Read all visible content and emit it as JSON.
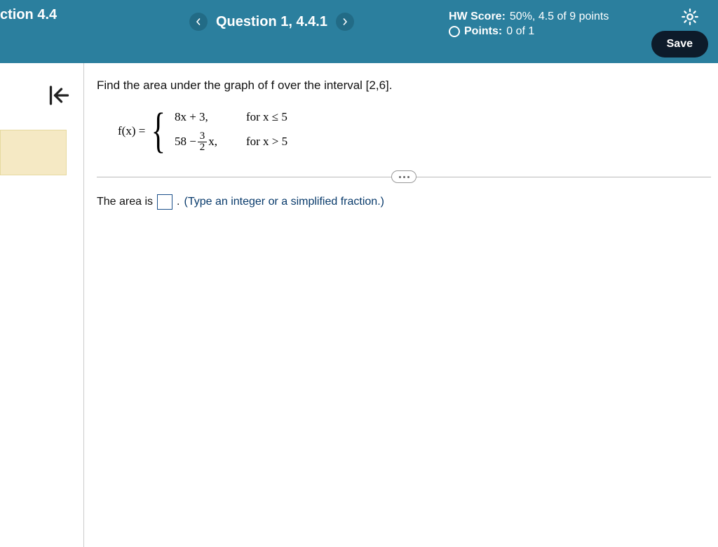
{
  "header": {
    "section_title": "ction 4.4",
    "question_label": "Question 1, 4.4.1",
    "hw_score_label": "HW Score:",
    "hw_score_value": "50%, 4.5 of 9 points",
    "points_label": "Points:",
    "points_value": "0 of 1",
    "save_label": "Save"
  },
  "problem": {
    "prompt": "Find the area under the graph of f over the interval [2,6].",
    "fx_label": "f(x) =",
    "piece1_expr": "8x + 3,",
    "piece1_cond": "for x ≤ 5",
    "piece2_prefix": "58 −",
    "piece2_frac_num": "3",
    "piece2_frac_den": "2",
    "piece2_suffix": "x,",
    "piece2_cond": "for x > 5",
    "answer_lead": "The area is",
    "answer_period": ".",
    "answer_hint": "(Type an integer or a simplified fraction.)"
  }
}
